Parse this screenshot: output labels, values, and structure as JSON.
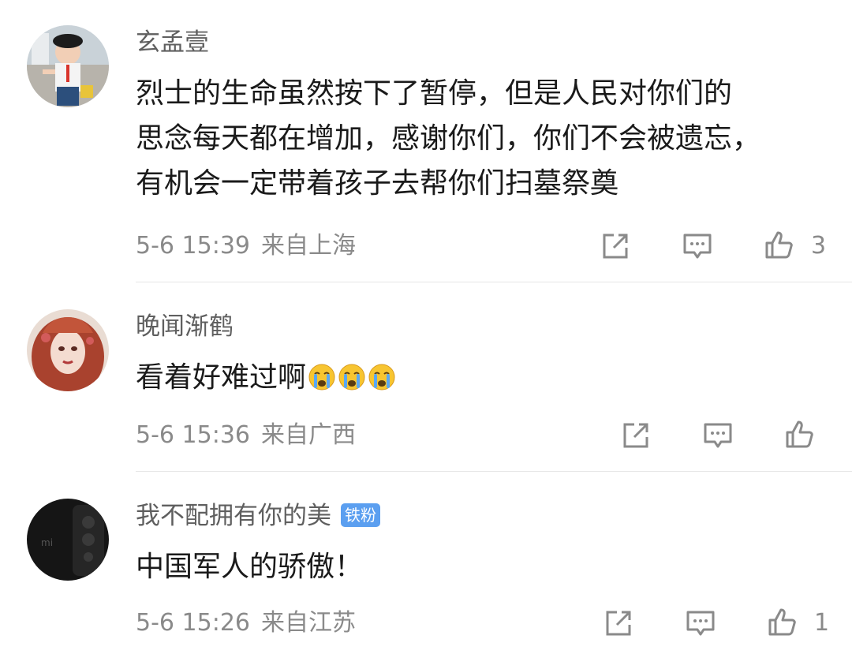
{
  "comments": [
    {
      "username": "玄孟壹",
      "badge": "",
      "lines": [
        "烈士的生命虽然按下了暂停，但是人民对你们的",
        "思念每天都在增加，感谢你们，你们不会被遗忘，",
        "有机会一定带着孩子去帮你们扫墓祭奠"
      ],
      "time": "5-6 15:39",
      "location": "来自上海",
      "like_count": "3",
      "avatar_icon": "child-photo-avatar"
    },
    {
      "username": "晚闻渐鹤",
      "badge": "",
      "text": "看着好难过啊",
      "emojis": [
        "crying-emoji",
        "crying-emoji",
        "crying-emoji"
      ],
      "time": "5-6 15:36",
      "location": "来自广西",
      "like_count": "",
      "avatar_icon": "illustrated-girl-avatar"
    },
    {
      "username": "我不配拥有你的美",
      "badge": "铁粉",
      "text": "中国军人的骄傲！",
      "time": "5-6 15:26",
      "location": "来自江苏",
      "like_count": "1",
      "avatar_icon": "dark-phone-avatar"
    }
  ],
  "icons": {
    "repost": "share-icon",
    "reply": "comment-icon",
    "like": "thumbs-up-icon"
  },
  "colors": {
    "username": "#5f5f5f",
    "text": "#1a1a1a",
    "meta": "#8a8a8a",
    "badge": "#5b9ff0",
    "divider": "#e6e6e6"
  }
}
